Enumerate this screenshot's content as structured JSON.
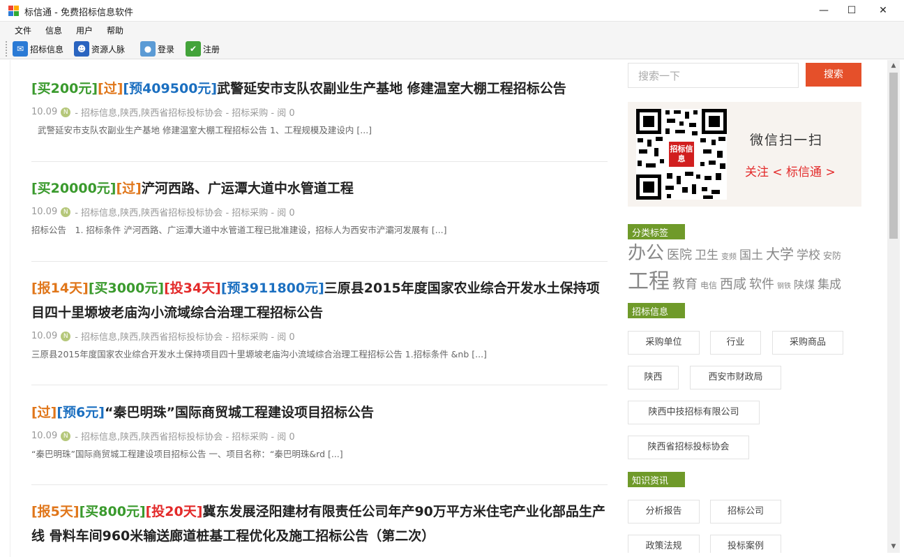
{
  "window": {
    "title": "标信通 - 免费招标信息软件",
    "minimize": "—",
    "maximize": "☐",
    "close": "✕"
  },
  "menu": [
    "文件",
    "信息",
    "用户",
    "帮助"
  ],
  "toolbar": [
    {
      "label": "招标信息",
      "icon": "mail-icon",
      "color": "#2a7ad5"
    },
    {
      "label": "资源人脉",
      "icon": "people-icon",
      "color": "#2a64c0"
    },
    {
      "label": "登录",
      "icon": "user-icon",
      "color": "#5b9bd5"
    },
    {
      "label": "注册",
      "icon": "check-icon",
      "color": "#43a33a"
    }
  ],
  "posts": [
    {
      "tags": [
        {
          "text": "[买200元]",
          "kind": "buy"
        },
        {
          "text": "[过]",
          "kind": "pass"
        },
        {
          "text": "[预409500元]",
          "kind": "budget"
        }
      ],
      "title": "武警延安市支队农副业生产基地 修建温室大棚工程招标公告",
      "date": "10.09",
      "meta": "- 招标信息,陕西,陕西省招标投标协会 - 招标采购 - 阅 0",
      "excerpt": "武警延安市支队农副业生产基地 修建温室大棚工程招标公告 1、工程规模及建设内 [...]"
    },
    {
      "tags": [
        {
          "text": "[买20000元]",
          "kind": "buy"
        },
        {
          "text": "[过]",
          "kind": "pass"
        }
      ],
      "title": "浐河西路、广运潭大道中水管道工程",
      "date": "10.09",
      "meta": "- 招标信息,陕西,陕西省招标投标协会 - 招标采购 - 阅 0",
      "excerpt": "招标公告　1. 招标条件 浐河西路、广运潭大道中水管道工程已批准建设，招标人为西安市浐灞河发展有 [...]"
    },
    {
      "tags": [
        {
          "text": "[报14天]",
          "kind": "days"
        },
        {
          "text": "[买3000元]",
          "kind": "buy"
        },
        {
          "text": "[投34天]",
          "kind": "bid"
        },
        {
          "text": "[预3911800元]",
          "kind": "budget"
        }
      ],
      "title": "三原县2015年度国家农业综合开发水土保持项目四十里塬坡老庙沟小流域综合治理工程招标公告",
      "date": "10.09",
      "meta": "- 招标信息,陕西,陕西省招标投标协会 - 招标采购 - 阅 0",
      "excerpt": "三原县2015年度国家农业综合开发水土保持项目四十里塬坡老庙沟小流域综合治理工程招标公告 1.招标条件 &nb [...]"
    },
    {
      "tags": [
        {
          "text": "[过]",
          "kind": "pass"
        },
        {
          "text": "[预6元]",
          "kind": "budget"
        }
      ],
      "title": "“秦巴明珠”国际商贸城工程建设项目招标公告",
      "date": "10.09",
      "meta": "- 招标信息,陕西,陕西省招标投标协会 - 招标采购 - 阅 0",
      "excerpt": "“秦巴明珠”国际商贸城工程建设项目招标公告 一、项目名称：“秦巴明珠&rd [...]"
    },
    {
      "tags": [
        {
          "text": "[报5天]",
          "kind": "days"
        },
        {
          "text": "[买800元]",
          "kind": "buy"
        },
        {
          "text": "[投20天]",
          "kind": "bid"
        }
      ],
      "title": "冀东发展泾阳建材有限责任公司年产90万平方米住宅产业化部品生产线 骨料车间960米输送廊道桩基工程优化及施工招标公告（第二次）",
      "date": "",
      "meta": "",
      "excerpt": ""
    }
  ],
  "sidebar": {
    "search_placeholder": "搜索一下",
    "search_button": "搜索",
    "qr_badge": "招标信息",
    "qr_text1": "微信扫一扫",
    "qr_text2": "关注 < 标信通 >",
    "section_tags": "分类标签",
    "tags_line1": [
      {
        "text": "办公",
        "size": 26
      },
      {
        "text": "医院",
        "size": 18
      },
      {
        "text": "卫生",
        "size": 17
      },
      {
        "text": "变频",
        "size": 11
      },
      {
        "text": "国土",
        "size": 17
      },
      {
        "text": "大学",
        "size": 20
      },
      {
        "text": "学校",
        "size": 17
      },
      {
        "text": "安防",
        "size": 13
      }
    ],
    "tags_line2": [
      {
        "text": "工程",
        "size": 30
      },
      {
        "text": "教育",
        "size": 18
      },
      {
        "text": "电信",
        "size": 12
      },
      {
        "text": "西咸",
        "size": 19
      },
      {
        "text": "软件",
        "size": 18
      },
      {
        "text": "钢铁",
        "size": 10
      },
      {
        "text": "陕煤",
        "size": 15
      },
      {
        "text": "集成",
        "size": 17
      }
    ],
    "section_bids": "招标信息",
    "bid_chips": [
      "采购单位",
      "行业",
      "采购商品",
      "陕西",
      "西安市财政局",
      "陕西中技招标有限公司",
      "陕西省招标投标协会"
    ],
    "section_knowledge": "知识资讯",
    "knowledge_chips": [
      "分析报告",
      "招标公司",
      "政策法规",
      "投标案例"
    ]
  }
}
